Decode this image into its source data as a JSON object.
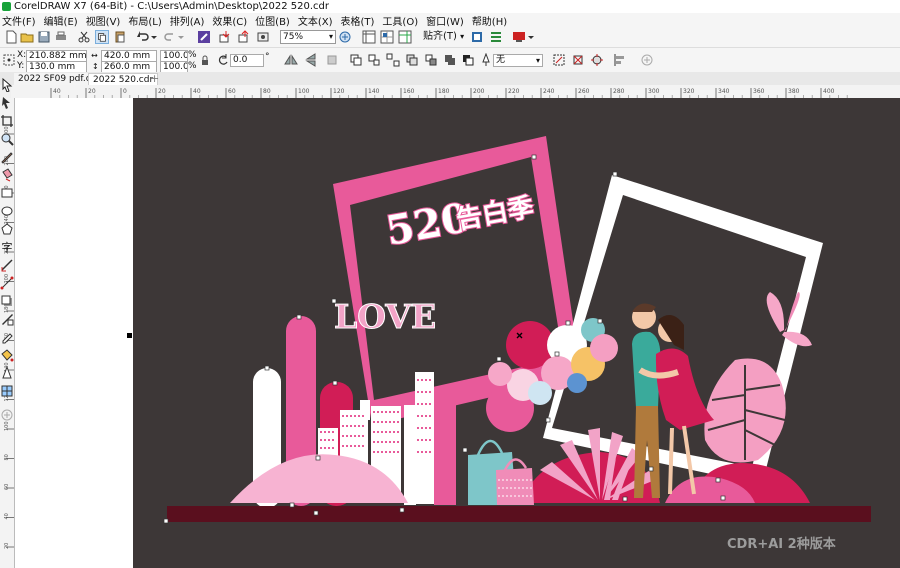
{
  "app": {
    "title": "CorelDRAW X7 (64-Bit) - C:\\Users\\Admin\\Desktop\\2022 520.cdr"
  },
  "menu": {
    "items": [
      "文件(F)",
      "编辑(E)",
      "视图(V)",
      "布局(L)",
      "排列(A)",
      "效果(C)",
      "位图(B)",
      "文本(X)",
      "表格(T)",
      "工具(O)",
      "窗口(W)",
      "帮助(H)"
    ]
  },
  "toolbar": {
    "zoom_value": "75%",
    "snap_label": "贴齐(T)"
  },
  "property_bar": {
    "x_label": "X:",
    "x_value": "210.882 mm",
    "y_label": "Y:",
    "y_value": "130.0 mm",
    "width_value": "420.0 mm",
    "height_value": "260.0 mm",
    "scale_w": "100.0",
    "scale_h": "100.0",
    "percent": "%",
    "rotation": "0.0",
    "degree": "°",
    "outline_value": "无"
  },
  "doc_tabs": [
    {
      "label": "2022 SF09 pdf.cdr",
      "active": false
    },
    {
      "label": "2022 520.cdr",
      "active": true
    }
  ],
  "rulers": {
    "h_ticks": [
      "40",
      "20",
      "0",
      "20",
      "40",
      "60",
      "80",
      "100",
      "120",
      "140",
      "160",
      "180",
      "200",
      "220",
      "240",
      "260",
      "280",
      "300",
      "320",
      "340",
      "360",
      "380",
      "400"
    ],
    "v_ticks": [
      "300",
      "280",
      "260",
      "240",
      "220",
      "200",
      "180",
      "160",
      "140",
      "120",
      "100",
      "80",
      "60",
      "40",
      "20",
      "0"
    ]
  },
  "artwork": {
    "badge_number": "520",
    "badge_text": "告白季",
    "love_text": "LOVE",
    "background_color": "#3d3737",
    "pink": "#e85a9a",
    "deep_red": "#5a0f1e"
  },
  "watermark": "CDR+AI 2种版本"
}
